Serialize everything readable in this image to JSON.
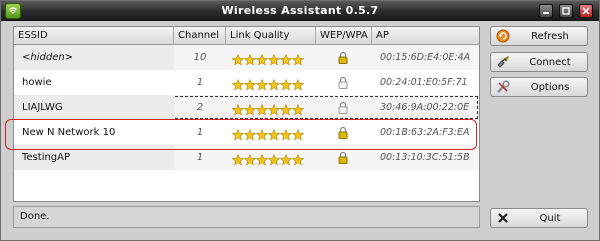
{
  "window": {
    "title": "Wireless Assistant 0.5.7"
  },
  "table": {
    "columns": [
      "ESSID",
      "Channel",
      "Link Quality",
      "WEP/WPA",
      "AP"
    ],
    "rows": [
      {
        "essid": "<hidden>",
        "channel": "10",
        "stars": 6,
        "secured": true,
        "ap": "00:15:6D:E4:0E:4A"
      },
      {
        "essid": "howie",
        "channel": "1",
        "stars": 6,
        "secured": false,
        "ap": "00:24:01:E0:5F:71"
      },
      {
        "essid": "LIAJLWG",
        "channel": "2",
        "stars": 6,
        "secured": false,
        "ap": "30:46:9A:00:22:0E"
      },
      {
        "essid": "New N Network 10",
        "channel": "1",
        "stars": 6,
        "secured": true,
        "ap": "00:1B:63:2A:F3:EA"
      },
      {
        "essid": "TestingAP",
        "channel": "1",
        "stars": 6,
        "secured": true,
        "ap": "00:13:10:3C:51:5B"
      }
    ]
  },
  "buttons": {
    "refresh": "Refresh",
    "connect": "Connect",
    "options": "Options",
    "quit": "Quit"
  },
  "status": "Done.",
  "colors": {
    "highlight": "#d2232a",
    "star": "#f2c51c",
    "lock": "#d8b800"
  }
}
